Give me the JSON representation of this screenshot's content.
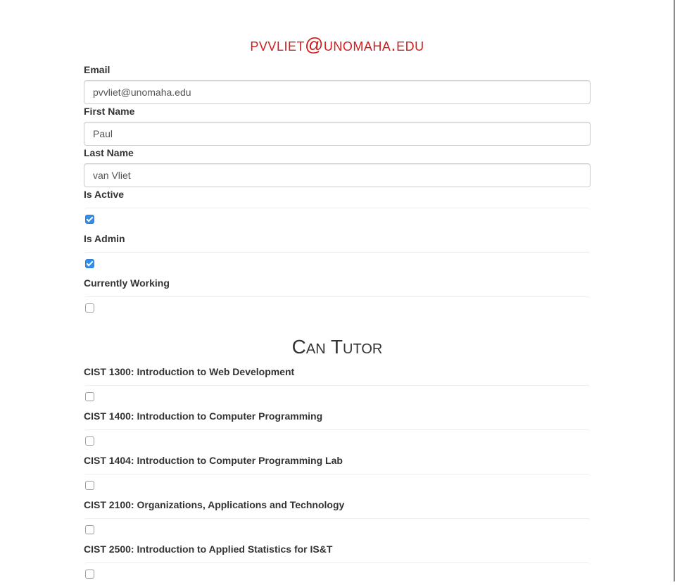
{
  "header": {
    "title": "pvvliet@unomaha.edu"
  },
  "form": {
    "email": {
      "label": "Email",
      "value": "pvvliet@unomaha.edu"
    },
    "first_name": {
      "label": "First Name",
      "value": "Paul"
    },
    "last_name": {
      "label": "Last Name",
      "value": "van Vliet"
    },
    "is_active": {
      "label": "Is Active",
      "checked": true
    },
    "is_admin": {
      "label": "Is Admin",
      "checked": true
    },
    "currently_working": {
      "label": "Currently Working",
      "checked": false
    }
  },
  "can_tutor": {
    "title": "Can Tutor",
    "courses": [
      {
        "label": "CIST 1300: Introduction to Web Development",
        "checked": false
      },
      {
        "label": "CIST 1400: Introduction to Computer Programming",
        "checked": false
      },
      {
        "label": "CIST 1404: Introduction to Computer Programming Lab",
        "checked": false
      },
      {
        "label": "CIST 2100: Organizations, Applications and Technology",
        "checked": false
      },
      {
        "label": "CIST 2500: Introduction to Applied Statistics for IS&T",
        "checked": false
      }
    ]
  },
  "colors": {
    "title_red": "#d11c1c",
    "checkbox_blue": "#2f8dec"
  }
}
